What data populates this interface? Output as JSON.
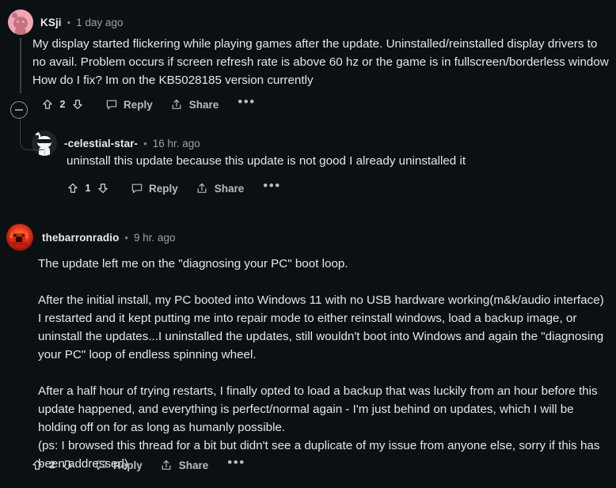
{
  "theme": {
    "background": "#0b1113",
    "text_primary": "#e4e7e9",
    "text_secondary": "#99a2a7",
    "username_color": "#e8eaed",
    "thread_line": "#3a4145"
  },
  "comments": [
    {
      "id": "c1",
      "username": "KSji",
      "separator": "•",
      "timestamp": "1 day ago",
      "avatar_name": "avatar-snoo-pink",
      "depth": 0,
      "collapse_button": true,
      "paragraphs": [
        [
          "My display started flickering while playing games after the update. Uninstalled/reinstalled display drivers to",
          "no avail. Problem occurs if screen refresh rate is above 60 hz or the game is in fullscreen/borderless window",
          "How do I fix? Im on the KB5028185 version currently"
        ]
      ],
      "actions": {
        "vote_count": "2",
        "upvote_label": "upvote",
        "downvote_label": "downvote",
        "reply_label": "Reply",
        "share_label": "Share",
        "more_label": "•••"
      }
    },
    {
      "id": "c2",
      "username": "-celestial-star-",
      "separator": "•",
      "timestamp": "16 hr. ago",
      "avatar_name": "avatar-snoo-sunglasses",
      "depth": 1,
      "collapse_button": false,
      "paragraphs": [
        [
          "uninstall this update because this update is not good I already uninstalled it"
        ]
      ],
      "actions": {
        "vote_count": "1",
        "upvote_label": "upvote",
        "downvote_label": "downvote",
        "reply_label": "Reply",
        "share_label": "Share",
        "more_label": "•••"
      }
    },
    {
      "id": "c3",
      "username": "thebarronradio",
      "separator": "•",
      "timestamp": "9 hr. ago",
      "avatar_name": "avatar-red-monster",
      "depth": 0,
      "collapse_button": false,
      "paragraphs": [
        [
          "The update left me on the \"diagnosing your PC\" boot loop."
        ],
        [
          "After the initial install, my PC booted into Windows 11 with no USB hardware working(m&k/audio interface)",
          "I restarted and it kept putting me into repair mode to either reinstall windows, load a backup image, or",
          "uninstall the updates...I uninstalled the updates, still wouldn't boot into Windows and again the \"diagnosing",
          "your PC\" loop of endless spinning wheel."
        ],
        [
          "After a half hour of trying restarts, I finally opted to load a backup that was luckily from an hour before this",
          "update happened, and everything is perfect/normal again - I'm just behind on updates, which I will be",
          "holding off on for as long as humanly possible.",
          "(ps: I browsed this thread for a bit but didn't see a duplicate of my issue from anyone else, sorry if this has",
          "been addressed)"
        ]
      ],
      "actions": {
        "vote_count": "2",
        "upvote_label": "upvote",
        "downvote_label": "downvote",
        "reply_label": "Reply",
        "share_label": "Share",
        "more_label": "•••"
      }
    }
  ]
}
